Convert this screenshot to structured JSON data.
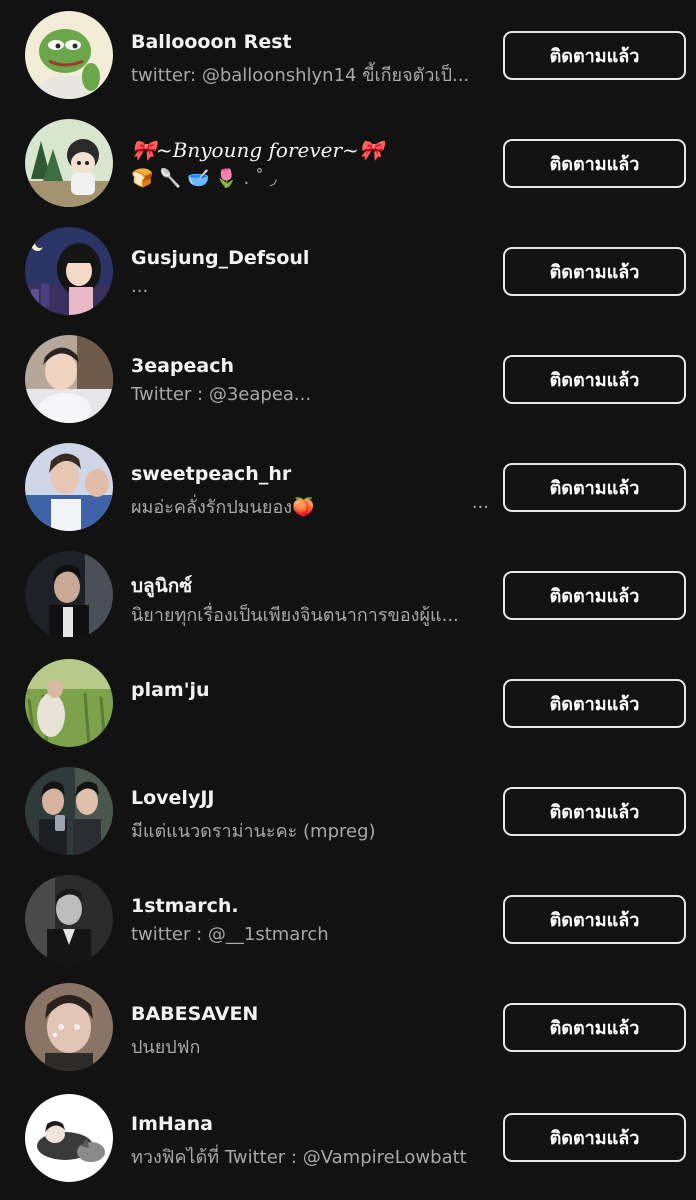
{
  "follow_label": "ติดตามแล้ว",
  "users": [
    {
      "name": "Balloooon Rest",
      "bio": "twitter: @balloonshlyn14 ขี้เกียจตัวเป็..."
    },
    {
      "name": "🎀~Bnyoung forever~🎀",
      "bio": "🍞 🥄 🥣 🌷 . ˚ ◞"
    },
    {
      "name": "Gusjung_Defsoul",
      "bio": "..."
    },
    {
      "name": "3eapeach",
      "bio": "Twitter : @3eapea..."
    },
    {
      "name": "sweetpeach_hr",
      "bio": "ผมอ่ะคลั่งรักปมนยอง🍑",
      "bio_more": "..."
    },
    {
      "name": "บลูนิกซ์",
      "bio": "นิยายทุกเรื่องเป็นเพียงจินตนาการของผู้แ..."
    },
    {
      "name": "plam'ju",
      "bio": ""
    },
    {
      "name": "LovelyJJ",
      "bio": "มีแต่แนวดราม่านะคะ (mpreg)"
    },
    {
      "name": "1stmarch.",
      "bio": "twitter : @__1stmarch"
    },
    {
      "name": "BABESAVEN",
      "bio": "ปนยปฟก"
    },
    {
      "name": "ImHana",
      "bio": "ทวงฟิคได้ที่ Twitter : @VampireLowbatt"
    }
  ],
  "avatar_icons": [
    "frog-meme-avatar-icon",
    "cartoon-couple-avatar-icon",
    "anime-girl-night-avatar-icon",
    "person-photo-avatar-icon",
    "person-photo-avatar-icon",
    "person-photo-avatar-icon",
    "grass-photo-avatar-icon",
    "two-people-photo-avatar-icon",
    "person-photo-avatar-icon",
    "person-photo-avatar-icon",
    "sleeping-cartoon-avatar-icon"
  ],
  "colors": {
    "background": "#121212",
    "name_text": "#f2f2f2",
    "bio_text": "#a8a8a8",
    "button_border": "#e8e8e8"
  }
}
